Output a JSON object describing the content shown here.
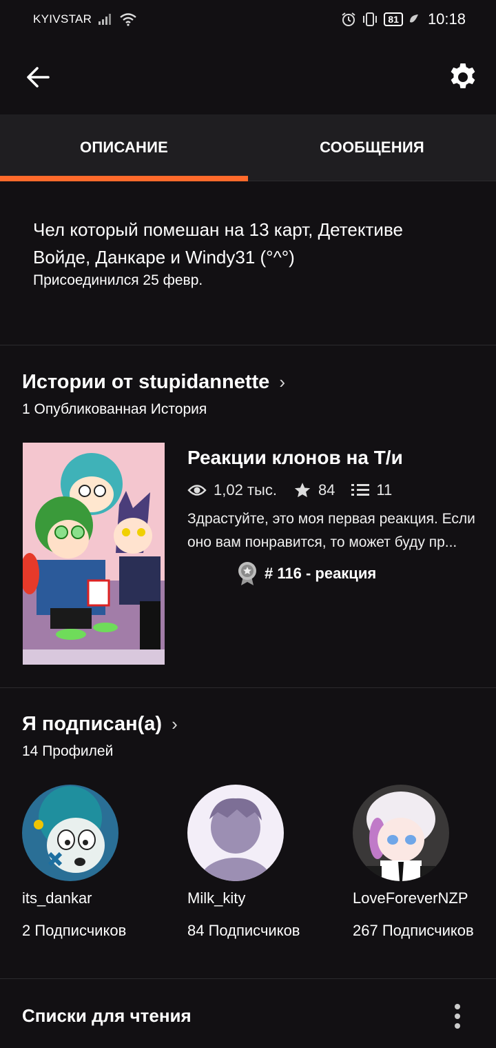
{
  "status": {
    "carrier": "KYIVSTAR",
    "battery": "81",
    "time": "10:18"
  },
  "tabs": [
    {
      "label": "ОПИСАНИЕ",
      "active": true
    },
    {
      "label": "СООБЩЕНИЯ",
      "active": false
    }
  ],
  "about": {
    "text": "Чел который помешан на 13 карт, Детективе Войде, Данкаре и Windy31 (°^°)",
    "joined": "Присоединился 25 февр."
  },
  "stories": {
    "title": "Истории от stupidannette",
    "subtitle": "1 Опубликованная История",
    "items": [
      {
        "title": "Реакции клонов на Т/и",
        "views": "1,02 тыс.",
        "votes": "84",
        "parts": "11",
        "description": "Здрастуйте, это моя первая реакция. Если оно вам понравится, то может буду пр...",
        "rank": "# 116 - реакция"
      }
    ]
  },
  "following": {
    "title": "Я подписан(а)",
    "subtitle": "14 Профилей",
    "profiles": [
      {
        "name": "its_dankar",
        "followers": "2 Подписчиков"
      },
      {
        "name": "Milk_kity",
        "followers": "84 Подписчиков"
      },
      {
        "name": "LoveForeverNZP",
        "followers": "267 Подписчиков"
      }
    ]
  },
  "reading": {
    "title": "Списки для чтения"
  },
  "colors": {
    "accent": "#ff6a2b",
    "background": "#121013",
    "tab_bar": "#1f1e21"
  }
}
